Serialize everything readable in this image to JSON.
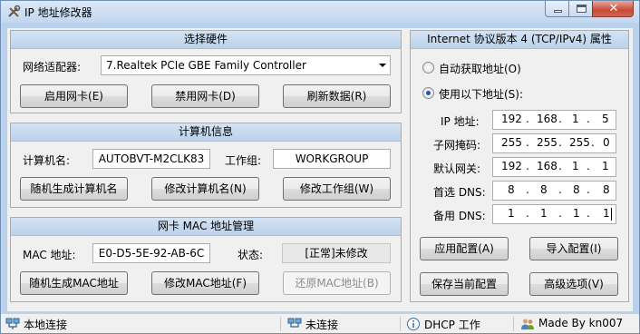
{
  "window": {
    "title": "IP 地址修改器"
  },
  "hardware": {
    "title": "选择硬件",
    "adapter_label": "网络适配器:",
    "adapter_value": "7.Realtek PCIe GBE Family Controller",
    "enable_btn": "启用网卡(E)",
    "disable_btn": "禁用网卡(D)",
    "refresh_btn": "刷新数据(R)"
  },
  "computer": {
    "title": "计算机信息",
    "name_label": "计算机名:",
    "name_value": "AUTOBVT-M2CLK83",
    "workgroup_label": "工作组:",
    "workgroup_value": "WORKGROUP",
    "random_name_btn": "随机生成计算机名",
    "edit_name_btn": "修改计算机名(N)",
    "edit_workgroup_btn": "修改工作组(W)"
  },
  "mac": {
    "title": "网卡 MAC 地址管理",
    "mac_label": "MAC 地址:",
    "mac_value": "E0-D5-5E-92-AB-6C",
    "status_label": "状态:",
    "status_value": "[正常]未修改",
    "random_btn": "随机生成MAC地址",
    "edit_btn": "修改MAC地址(F)",
    "restore_btn": "还原MAC地址(B)"
  },
  "ipv4": {
    "title": "Internet 协议版本 4 (TCP/IPv4) 属性",
    "auto_label": "自动获取地址(O)",
    "manual_label": "使用以下地址(S):",
    "selected": "manual",
    "ip_label": "IP 地址:",
    "ip": [
      "192",
      "168",
      "1",
      "5"
    ],
    "mask_label": "子网掩码:",
    "mask": [
      "255",
      "255",
      "255",
      "0"
    ],
    "gateway_label": "默认网关:",
    "gateway": [
      "192",
      "168",
      "1",
      "1"
    ],
    "dns1_label": "首选 DNS:",
    "dns1": [
      "8",
      "8",
      "8",
      "8"
    ],
    "dns2_label": "备用 DNS:",
    "dns2": [
      "1",
      "1",
      "1",
      "1"
    ],
    "apply_btn": "应用配置(A)",
    "import_btn": "导入配置(I)",
    "save_btn": "保存当前配置",
    "advanced_btn": "高级选项(V)"
  },
  "statusbar": {
    "connection": "本地连接",
    "link_state": "未连接",
    "dhcp": "DHCP 工作",
    "author": "Made By kn007"
  },
  "colors": {
    "frame": "#b9d1ea",
    "group_header": "#c8dbef",
    "close_button": "#c74a36"
  },
  "icons": [
    "tools-icon",
    "network-icon",
    "disconnected-network-icon",
    "info-icon",
    "users-icon"
  ]
}
